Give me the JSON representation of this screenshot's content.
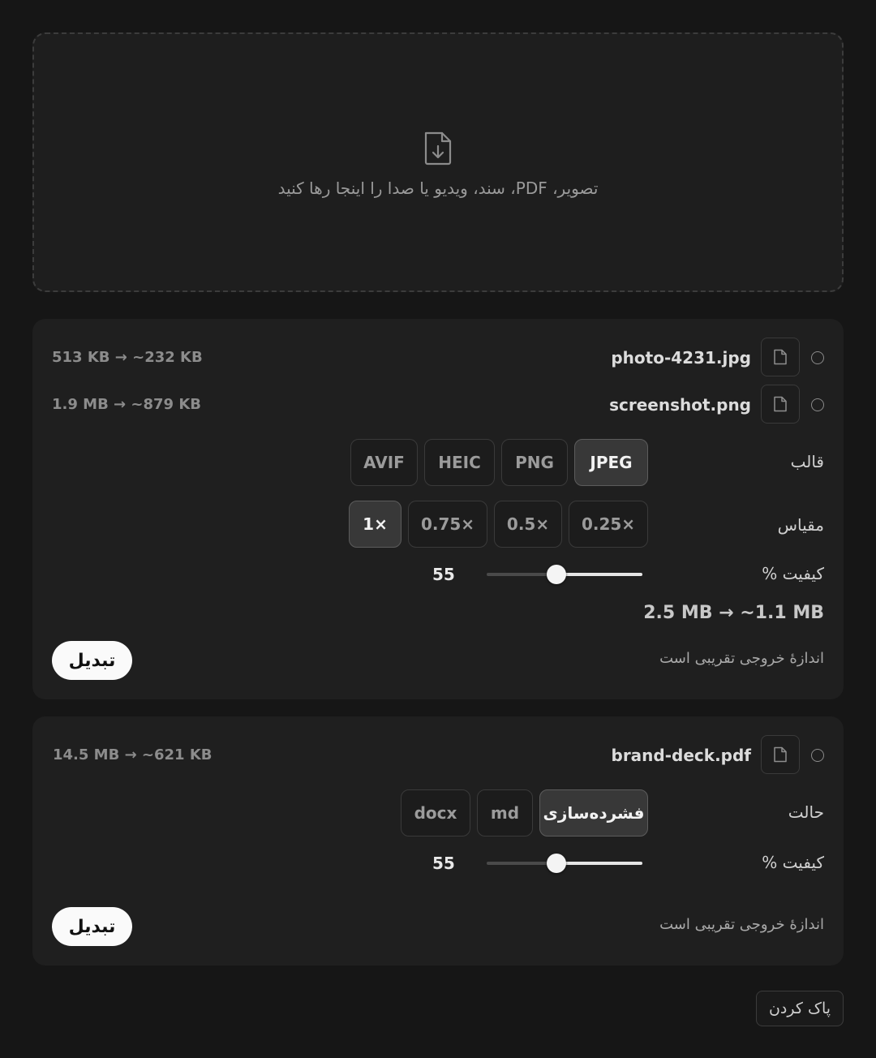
{
  "dropzone": {
    "text": "تصویر، PDF، سند، ویدیو یا صدا را اینجا رها کنید",
    "icon": "file-download-icon"
  },
  "image_group": {
    "files": [
      {
        "name": "photo-4231.jpg",
        "size": "513 KB → ~232 KB"
      },
      {
        "name": "screenshot.png",
        "size": "1.9 MB → ~879 KB"
      }
    ],
    "format_label": "قالب",
    "formats": [
      "AVIF",
      "HEIC",
      "PNG",
      "JPEG"
    ],
    "format_selected": "JPEG",
    "scale_label": "مقیاس",
    "scales": [
      "1×",
      "0.75×",
      "0.5×",
      "0.25×"
    ],
    "scale_selected": "1×",
    "quality_label": "کیفیت %",
    "quality_value": "55",
    "quality_fraction": 0.45,
    "total": "2.5 MB → ~1.1 MB",
    "note": "اندازهٔ خروجی تقریبی است",
    "convert_label": "تبدیل"
  },
  "pdf_group": {
    "files": [
      {
        "name": "brand-deck.pdf",
        "size": "14.5 MB → ~621 KB"
      }
    ],
    "mode_label": "حالت",
    "modes": [
      "docx",
      "md",
      "فشرده‌سازی"
    ],
    "mode_selected": "فشرده‌سازی",
    "quality_label": "کیفیت %",
    "quality_value": "55",
    "quality_fraction": 0.45,
    "note": "اندازهٔ خروجی تقریبی است",
    "convert_label": "تبدیل"
  },
  "clear_label": "پاک کردن"
}
